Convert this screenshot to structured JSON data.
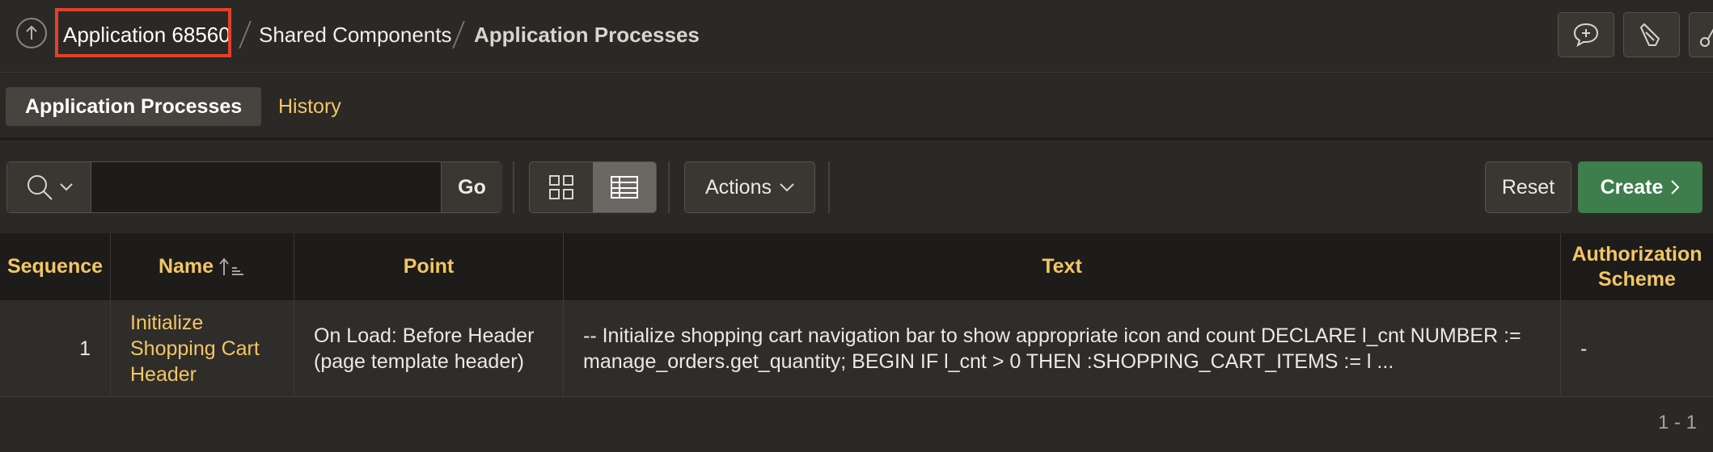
{
  "breadcrumb": {
    "items": [
      "Application 68560",
      "Shared Components",
      "Application Processes"
    ]
  },
  "toolbar_top": {
    "icons": [
      "feedback-icon",
      "developer-tools-icon",
      "shared-tool-icon"
    ]
  },
  "tabs": [
    {
      "label": "Application Processes",
      "active": true
    },
    {
      "label": "History",
      "active": false
    }
  ],
  "search": {
    "value": "",
    "placeholder": "",
    "go_label": "Go"
  },
  "actions_label": "Actions",
  "reset_label": "Reset",
  "create_label": "Create",
  "table": {
    "headers": [
      "Sequence",
      "Name",
      "Point",
      "Text",
      "Authorization Scheme"
    ],
    "rows": [
      {
        "sequence": "1",
        "name": "Initialize Shopping Cart Header",
        "point": "On Load: Before Header (page template header)",
        "text": "-- Initialize shopping cart navigation bar to show appropriate icon and count DECLARE l_cnt NUMBER := manage_orders.get_quantity; BEGIN IF l_cnt > 0 THEN :SHOPPING_CART_ITEMS := l ...",
        "authorization": "-"
      }
    ]
  },
  "pagination": "1 - 1",
  "colors": {
    "accent": "#f3c664",
    "create": "#3e7d4c",
    "highlight": "#e4402b",
    "background": "#2b2926"
  }
}
